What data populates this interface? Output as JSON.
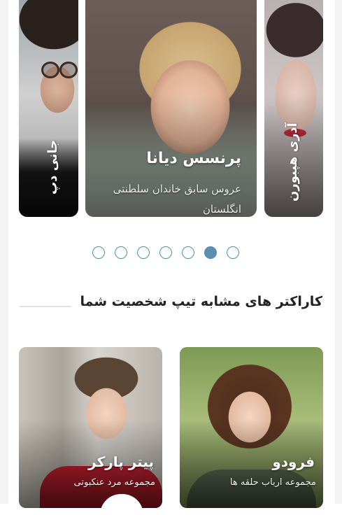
{
  "carousel": {
    "cards": [
      {
        "label": "جانی دپ"
      },
      {
        "title": "پرنسس دیانا",
        "subtitle": "عروس سابق خاندان سلطنتی انگلستان"
      },
      {
        "label": "آدری هپبورن"
      }
    ],
    "dots_total": 7,
    "active_dot": 6
  },
  "section": {
    "title": "کاراکتر های مشابه تیپ شخصیت شما"
  },
  "characters": [
    {
      "name": "پیتر پارکر",
      "subtitle": "مجموعه مرد عنکبوتی"
    },
    {
      "name": "فرودو",
      "subtitle": "مجموعه ارباب حلقه ها"
    }
  ],
  "colors": {
    "accent": "#5a8fb0",
    "heading": "#222222"
  }
}
